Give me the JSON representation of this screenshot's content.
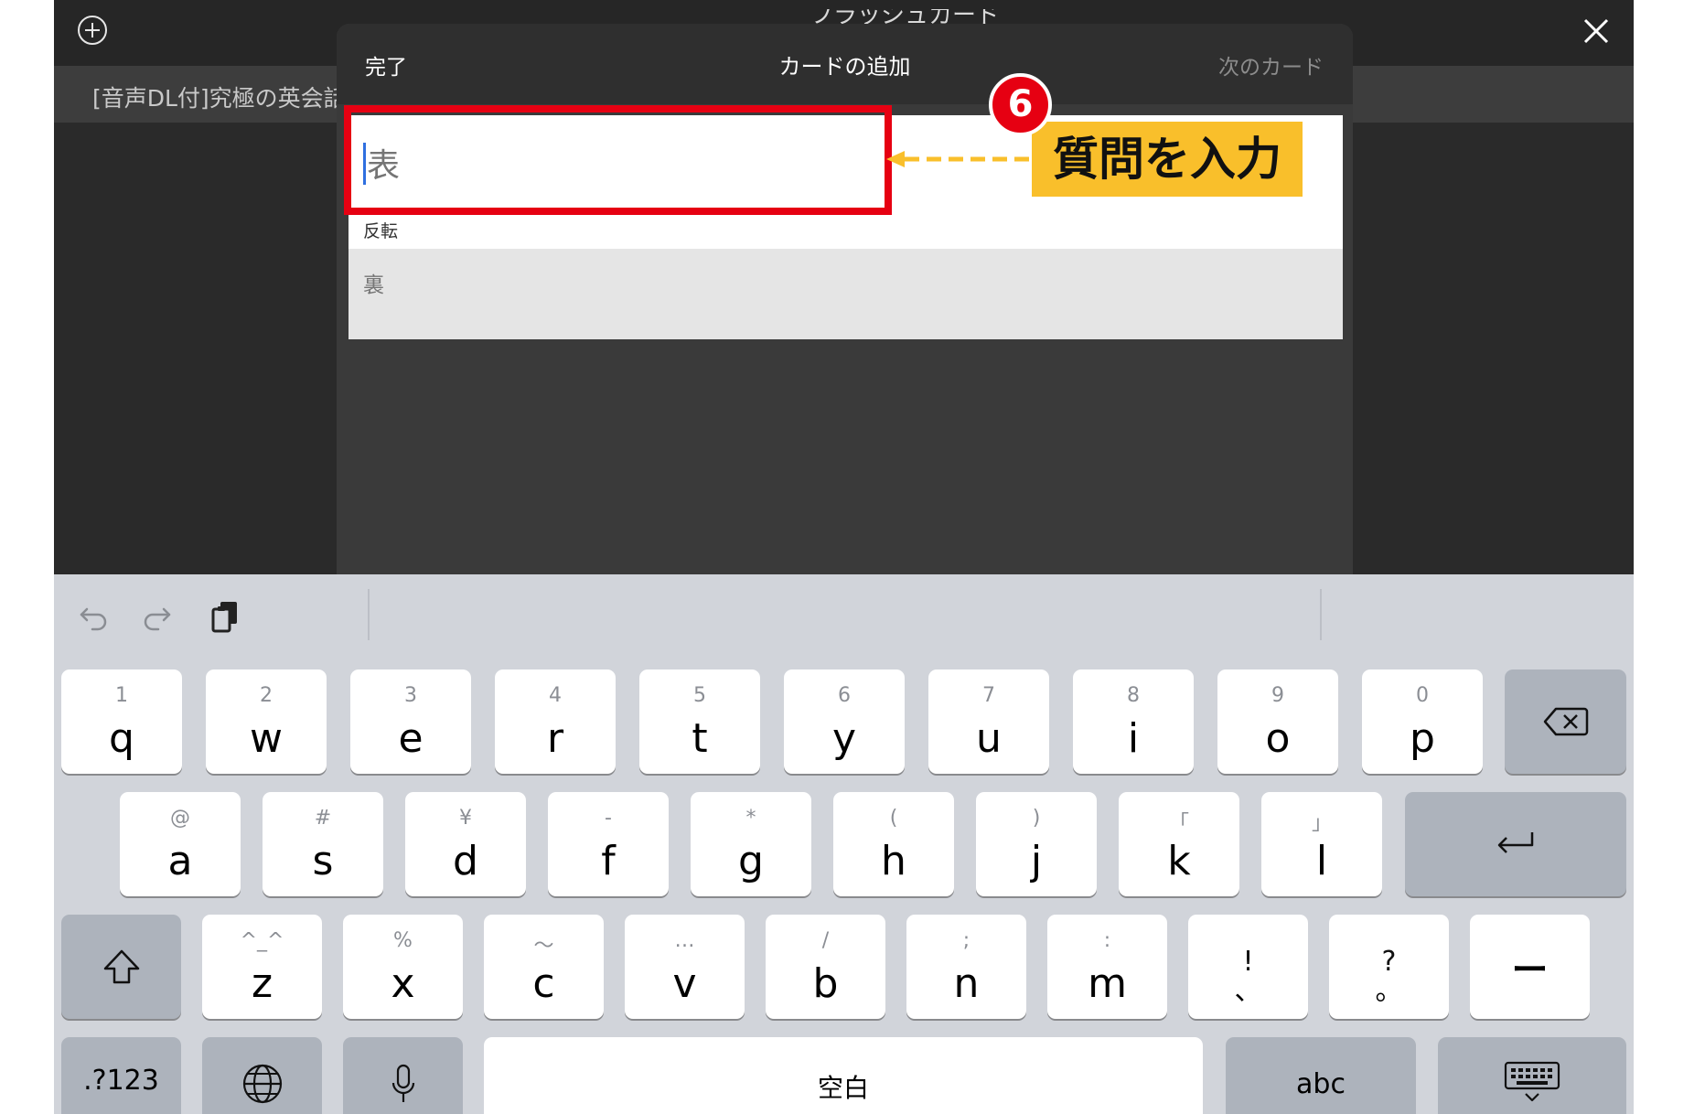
{
  "app": {
    "title_peek": "フラッシュカード",
    "deck_title": "[音声DL付]究極の英会話"
  },
  "modal": {
    "done_label": "完了",
    "title": "カードの追加",
    "next_label": "次のカード",
    "front_placeholder": "表",
    "flip_label": "反転",
    "back_placeholder": "裏"
  },
  "annotation": {
    "step_number": "6",
    "callout_text": "質問を入力",
    "highlight_color": "#e60012",
    "callout_color": "#f9bf2b"
  },
  "keyboard": {
    "row1": [
      {
        "sub": "1",
        "main": "q"
      },
      {
        "sub": "2",
        "main": "w"
      },
      {
        "sub": "3",
        "main": "e"
      },
      {
        "sub": "4",
        "main": "r"
      },
      {
        "sub": "5",
        "main": "t"
      },
      {
        "sub": "6",
        "main": "y"
      },
      {
        "sub": "7",
        "main": "u"
      },
      {
        "sub": "8",
        "main": "i"
      },
      {
        "sub": "9",
        "main": "o"
      },
      {
        "sub": "0",
        "main": "p"
      }
    ],
    "row2": [
      {
        "sub": "@",
        "main": "a"
      },
      {
        "sub": "#",
        "main": "s"
      },
      {
        "sub": "¥",
        "main": "d"
      },
      {
        "sub": "-",
        "main": "f"
      },
      {
        "sub": "*",
        "main": "g"
      },
      {
        "sub": "(",
        "main": "h"
      },
      {
        "sub": ")",
        "main": "j"
      },
      {
        "sub": "「",
        "main": "k"
      },
      {
        "sub": "」",
        "main": "l"
      }
    ],
    "row3": [
      {
        "sub": "^_^",
        "main": "z"
      },
      {
        "sub": "%",
        "main": "x"
      },
      {
        "sub": "〜",
        "main": "c"
      },
      {
        "sub": "…",
        "main": "v"
      },
      {
        "sub": "/",
        "main": "b"
      },
      {
        "sub": ";",
        "main": "n"
      },
      {
        "sub": ":",
        "main": "m"
      },
      {
        "sub": "!",
        "main": "、"
      },
      {
        "sub": "?",
        "main": "。"
      }
    ],
    "dash_key": "ー",
    "numbers_key": ".?123",
    "space_key": "空白",
    "abc_key": "abc",
    "icons": [
      "undo-icon",
      "redo-icon",
      "clipboard-icon",
      "delete-icon",
      "return-icon",
      "shift-icon",
      "globe-icon",
      "microphone-icon",
      "keyboard-dismiss-icon"
    ]
  }
}
